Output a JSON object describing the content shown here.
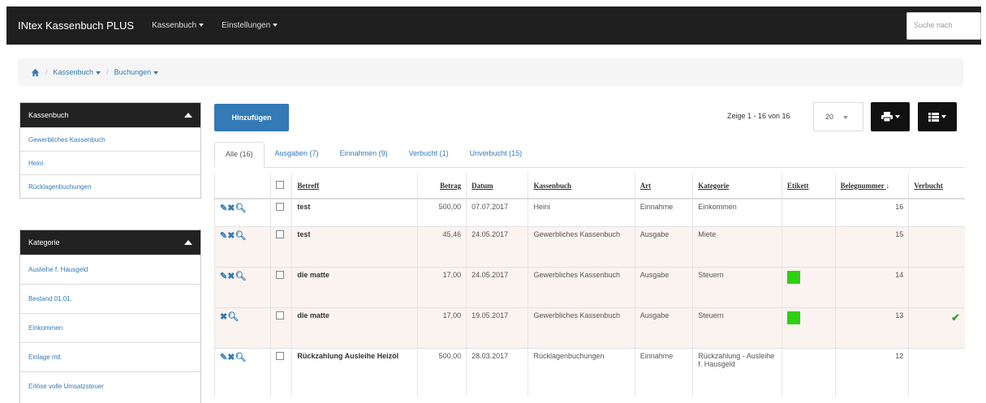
{
  "app": {
    "brand": "INtex Kassenbuch PLUS",
    "nav": [
      "Kassenbuch",
      "Einstellungen"
    ],
    "search_placeholder": "Suche nach"
  },
  "breadcrumb": [
    "Kassenbuch",
    "Buchungen"
  ],
  "sidebar": {
    "panels": [
      {
        "title": "Kassenbuch",
        "items": [
          "Gewerbliches Kassenbuch",
          "Heini",
          "Rücklagenbuchungen"
        ]
      },
      {
        "title": "Kategorie",
        "items": [
          "Ausleihe f. Hausgeld",
          "Bestand 01.01.",
          "Einkommen",
          "Einlage mtl.",
          "Erlöse volle Umsatzsteuer"
        ]
      }
    ]
  },
  "toolbar": {
    "add_label": "Hinzufügen",
    "pager_text": "Zeige 1 - 16 von 16",
    "page_size": "20"
  },
  "tabs": [
    "Alle (16)",
    "Ausgaben (7)",
    "Einnahmen (9)",
    "Verbucht (1)",
    "Unverbucht (15)"
  ],
  "table": {
    "headers": [
      "Betreff",
      "Betrag",
      "Datum",
      "Kassenbuch",
      "Art",
      "Kategorie",
      "Etikett",
      "Belegnummer",
      "Verbucht"
    ],
    "rows": [
      {
        "betreff": "test",
        "betrag": "500,00",
        "datum": "07.07.2017",
        "kassenbuch": "Heini",
        "art": "Einnahme",
        "kategorie": "Einkommen",
        "etikett": "",
        "beleg": "16",
        "verbucht": "",
        "edit": true
      },
      {
        "betreff": "test",
        "betrag": "45,46",
        "datum": "24.05.2017",
        "kassenbuch": "Gewerbliches Kassenbuch",
        "art": "Ausgabe",
        "kategorie": "Miete",
        "etikett": "",
        "beleg": "15",
        "verbucht": "",
        "edit": true
      },
      {
        "betreff": "die matte",
        "betrag": "17,00",
        "datum": "24.05.2017",
        "kassenbuch": "Gewerbliches Kassenbuch",
        "art": "Ausgabe",
        "kategorie": "Steuern",
        "etikett": "#2dd10f",
        "beleg": "14",
        "verbucht": "",
        "edit": true
      },
      {
        "betreff": "die matte",
        "betrag": "17,00",
        "datum": "19.05.2017",
        "kassenbuch": "Gewerbliches Kassenbuch",
        "art": "Ausgabe",
        "kategorie": "Steuern",
        "etikett": "#2dd10f",
        "beleg": "13",
        "verbucht": "✔",
        "edit": false
      },
      {
        "betreff": "Rückzahlung Ausleihe Heizöl",
        "betrag": "500,00",
        "datum": "28.03.2017",
        "kassenbuch": "Rücklagenbuchungen",
        "art": "Einnahme",
        "kategorie": "Rückzahlung - Ausleihe f. Hausgeld",
        "etikett": "",
        "beleg": "12",
        "verbucht": "",
        "edit": true
      }
    ]
  },
  "icons": [
    "home-icon",
    "edit-icon",
    "delete-icon",
    "search-icon",
    "print-icon",
    "columns-icon",
    "sort-arrow-icon",
    "check-icon"
  ]
}
